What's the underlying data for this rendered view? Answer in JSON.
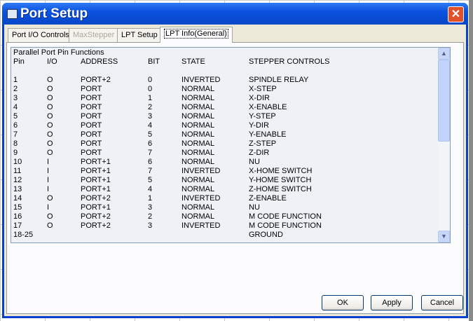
{
  "window": {
    "title": "Port Setup"
  },
  "tabs": [
    {
      "label": "Port I/O Controls",
      "state": "normal"
    },
    {
      "label": "MaxStepper",
      "state": "disabled"
    },
    {
      "label": "LPT Setup",
      "state": "normal"
    },
    {
      "label": "LPT Info(General)",
      "state": "active"
    }
  ],
  "info": {
    "heading": "Parallel Port Pin Functions",
    "columns": [
      "Pin",
      "I/O",
      "ADDRESS",
      "BIT",
      "STATE",
      "STEPPER CONTROLS"
    ],
    "rows": [
      [
        "1",
        "O",
        "PORT+2",
        "0",
        "INVERTED",
        "SPINDLE RELAY"
      ],
      [
        "2",
        "O",
        "PORT",
        "0",
        "NORMAL",
        "X-STEP"
      ],
      [
        "3",
        "O",
        "PORT",
        "1",
        "NORMAL",
        "X-DIR"
      ],
      [
        "4",
        "O",
        "PORT",
        "2",
        "NORMAL",
        "X-ENABLE"
      ],
      [
        "5",
        "O",
        "PORT",
        "3",
        "NORMAL",
        "Y-STEP"
      ],
      [
        "6",
        "O",
        "PORT",
        "4",
        "NORMAL",
        "Y-DIR"
      ],
      [
        "7",
        "O",
        "PORT",
        "5",
        "NORMAL",
        "Y-ENABLE"
      ],
      [
        "8",
        "O",
        "PORT",
        "6",
        "NORMAL",
        "Z-STEP"
      ],
      [
        "9",
        "O",
        "PORT",
        "7",
        "NORMAL",
        "Z-DIR"
      ],
      [
        "10",
        "I",
        "PORT+1",
        "6",
        "NORMAL",
        "NU"
      ],
      [
        "11",
        "I",
        "PORT+1",
        "7",
        "INVERTED",
        "X-HOME SWITCH"
      ],
      [
        "12",
        "I",
        "PORT+1",
        "5",
        "NORMAL",
        "Y-HOME SWITCH"
      ],
      [
        "13",
        "I",
        "PORT+1",
        "4",
        "NORMAL",
        "Z-HOME SWITCH"
      ],
      [
        "14",
        "O",
        "PORT+2",
        "1",
        "INVERTED",
        "Z-ENABLE"
      ],
      [
        "15",
        "I",
        "PORT+1",
        "3",
        "NORMAL",
        "NU"
      ],
      [
        "16",
        "O",
        "PORT+2",
        "2",
        "NORMAL",
        "M CODE FUNCTION"
      ],
      [
        "17",
        "O",
        "PORT+2",
        "3",
        "INVERTED",
        "M CODE FUNCTION"
      ],
      [
        "18-25",
        "",
        "",
        "",
        "",
        "GROUND"
      ]
    ]
  },
  "buttons": {
    "ok": "OK",
    "apply": "Apply",
    "cancel": "Cancel"
  }
}
